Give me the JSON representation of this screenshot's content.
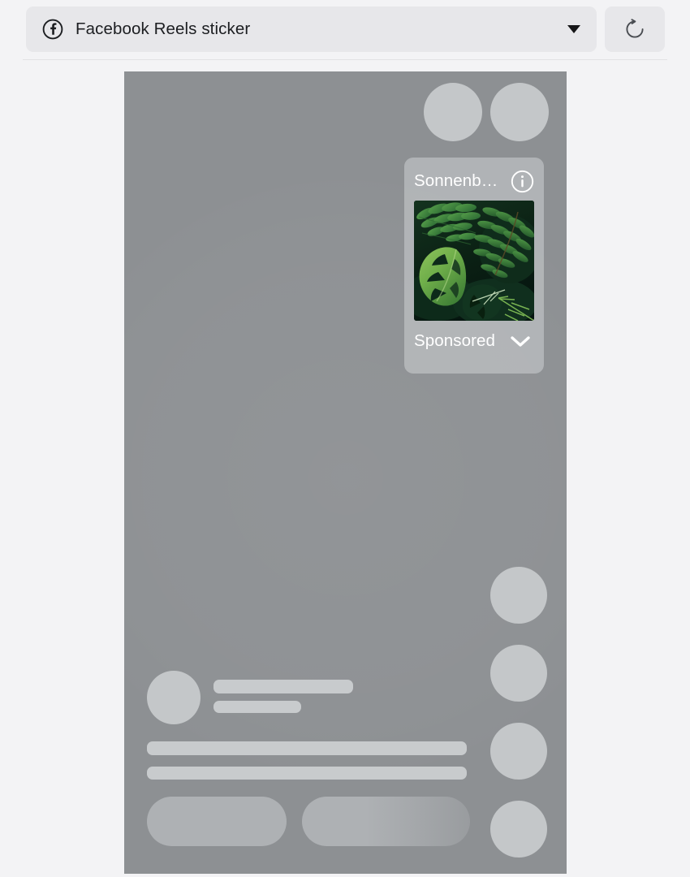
{
  "toolbar": {
    "surface_select": {
      "icon": "facebook-icon",
      "label": "Facebook Reels sticker",
      "caret_icon": "chevron-down-icon"
    },
    "refresh_button": {
      "icon": "refresh-icon",
      "label": "Refresh"
    }
  },
  "preview": {
    "background_color": "#8d9093",
    "skeleton": {
      "top_circles": 2,
      "rail_circles": 4,
      "profile_avatar": true,
      "profile_lines": 2,
      "caption_lines": 2,
      "action_pills": 2
    }
  },
  "sticker": {
    "title": "Sonnenb…",
    "info_icon": "info-circle-icon",
    "image_alt": "tropical-foliage-photo",
    "sponsored_label": "Sponsored",
    "chevron_icon": "chevron-down-icon",
    "card_color": "#d8dbdd",
    "text_color": "#ffffff"
  }
}
